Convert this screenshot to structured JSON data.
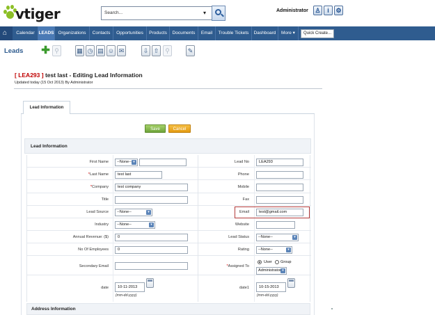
{
  "brand": {
    "logo_text": "vtiger"
  },
  "search": {
    "placeholder": "Search..."
  },
  "header": {
    "user": "Administrator"
  },
  "nav": {
    "tabs": [
      "Calendar",
      "LEADS",
      "Organizations",
      "Contacts",
      "Opportunities",
      "Products",
      "Documents",
      "Email",
      "Trouble Tickets",
      "Dashboard",
      "More ▾"
    ],
    "quick_create": "Quick Create..."
  },
  "module": {
    "title": "Leads"
  },
  "record": {
    "id": "[ LEA293 ]",
    "title": "test last - Editing Lead Information",
    "subtitle": "Updated today (15 Oct 2013) By Administrator"
  },
  "tabs": {
    "lead_info": "Lead Information"
  },
  "buttons": {
    "save": "Save",
    "cancel": "Cancel"
  },
  "block": {
    "lead_info": "Lead Information",
    "address_info": "Address Information"
  },
  "form": {
    "first_name_label": "First Name",
    "salutation": "--None--",
    "first_name": "",
    "last_name_label": "Last Name",
    "last_name": "test last",
    "company_label": "Company",
    "company": "test company",
    "title_label": "Title",
    "title": "",
    "lead_source_label": "Lead Source",
    "lead_source": "--None--",
    "industry_label": "Industry",
    "industry": "--None--",
    "annual_revenue_label": "Annual Revenue: ($)",
    "annual_revenue": "0",
    "employees_label": "No Of Employees",
    "employees": "0",
    "secondary_email_label": "Secondary Email",
    "secondary_email": "",
    "date_label": "date",
    "date": "10-11-2013",
    "date_format": "(mm-dd-yyyy)",
    "lead_no_label": "Lead No",
    "lead_no": "LEA293",
    "phone_label": "Phone",
    "phone": "",
    "mobile_label": "Mobile",
    "mobile": "",
    "fax_label": "Fax",
    "fax": "",
    "email_label": "Email",
    "email": "test@gmail.com",
    "website_label": "Website",
    "website": "",
    "lead_status_label": "Lead Status",
    "lead_status": "--None--",
    "rating_label": "Rating",
    "rating": "--None--",
    "assigned_to_label": "Assigned To",
    "assigned_user": "User",
    "assigned_group": "Group",
    "assigned_to": "Administrator",
    "date1_label": "date1",
    "date1": "10-15-2013",
    "date1_format": "(mm-dd-yyyy)"
  },
  "colors": {
    "nav": "#2f5c8f",
    "save": "#7cb342",
    "cancel": "#f0a82a",
    "required": "#dd0000",
    "record_id": "#c00000"
  }
}
